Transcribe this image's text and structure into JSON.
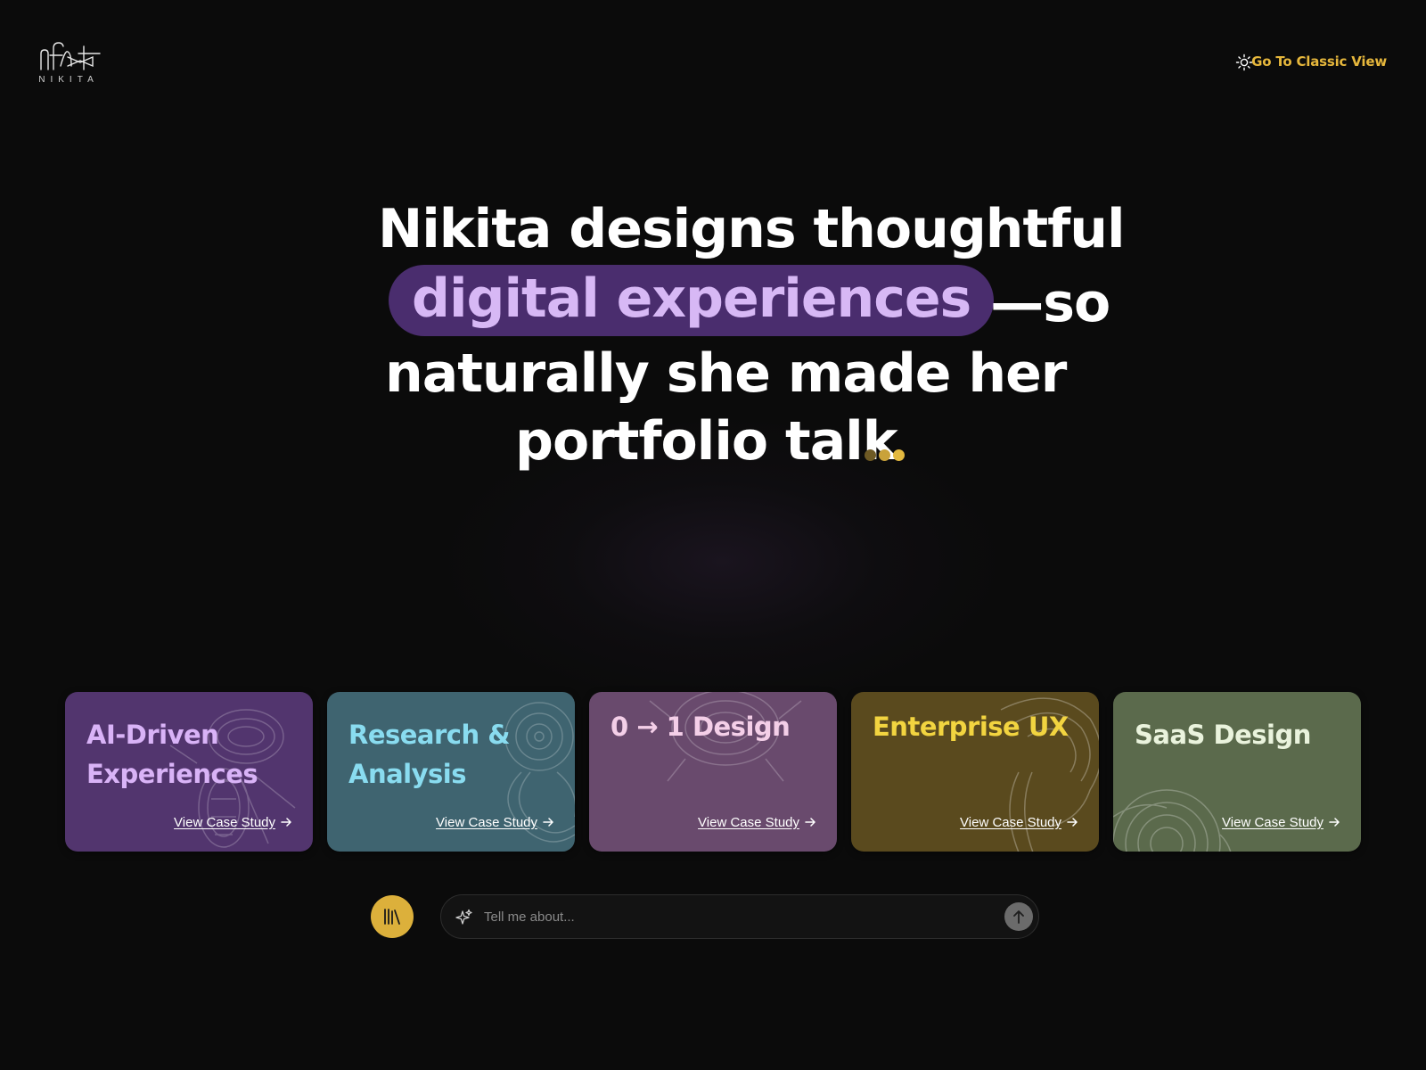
{
  "header": {
    "logo_wordmark": "NIKITA",
    "theme_toggle_icon": "sun-icon",
    "classic_view_label": "Go To Classic View"
  },
  "hero": {
    "line1": "Nikita designs thoughtful",
    "highlight": "digital experiences",
    "line2_suffix": "—so",
    "line3": "naturally she made her",
    "line4": "portfolio talk",
    "typing_indicator_icon": "typing-dots-icon"
  },
  "cards": [
    {
      "title": "AI-Driven Experiences",
      "link": "View Case Study",
      "bg": "#52356e",
      "title_color": "#d9b3f7"
    },
    {
      "title": "Research & Analysis",
      "link": "View Case Study",
      "bg": "#3f6470",
      "title_color": "#89dcf0"
    },
    {
      "title": "0 → 1 Design",
      "link": "View Case Study",
      "bg": "#694a6d",
      "title_color": "#f4cfe8"
    },
    {
      "title": "Enterprise UX",
      "link": "View Case Study",
      "bg": "#5a4a1e",
      "title_color": "#f2d440"
    },
    {
      "title": "SaaS Design",
      "link": "View Case Study",
      "bg": "#5b6a4c",
      "title_color": "#eaf3dd"
    }
  ],
  "chat": {
    "library_icon": "library-icon",
    "sparkle_icon": "sparkle-icon",
    "placeholder": "Tell me about...",
    "send_icon": "arrow-up-icon"
  },
  "colors": {
    "background": "#0b0b0b",
    "accent": "#e6b73c",
    "highlight_bg": "#4a2d6e",
    "highlight_text": "#d7b8f5"
  }
}
